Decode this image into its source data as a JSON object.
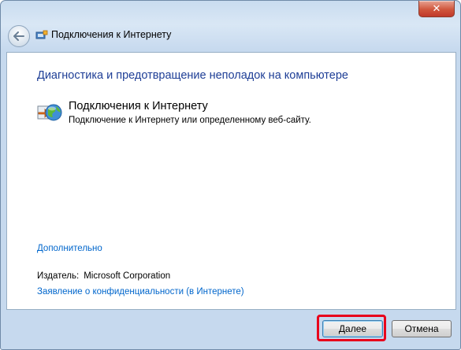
{
  "window": {
    "title": "Подключения к Интернету",
    "close_glyph": "✕"
  },
  "content": {
    "heading": "Диагностика и предотвращение неполадок на компьютере",
    "item": {
      "title": "Подключения к Интернету",
      "description": "Подключение к Интернету или определенному веб-сайту.",
      "icon": "network-troubleshooter-icon"
    },
    "advanced_link": "Дополнительно",
    "publisher_label": "Издатель:",
    "publisher_value": "Microsoft Corporation",
    "privacy_link": "Заявление о конфиденциальности (в Интернете)"
  },
  "footer": {
    "next_label": "Далее",
    "cancel_label": "Отмена"
  },
  "colors": {
    "heading": "#1e3e96",
    "link": "#0066cc",
    "highlight": "#e8001c"
  }
}
